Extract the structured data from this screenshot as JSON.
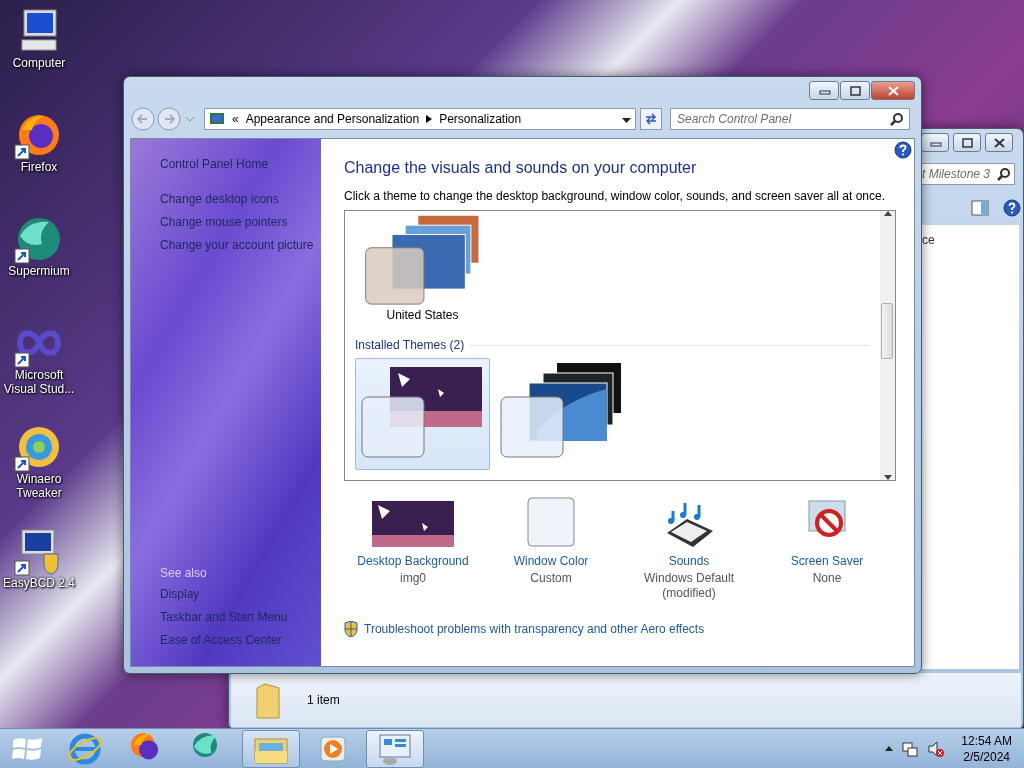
{
  "desktop_icons": [
    {
      "label": "Computer",
      "kind": "computer",
      "shortcut": false
    },
    {
      "label": "Firefox",
      "kind": "firefox",
      "shortcut": true
    },
    {
      "label": "Supermium",
      "kind": "supermium",
      "shortcut": true
    },
    {
      "label": "Microsoft Visual Stud...",
      "kind": "vs",
      "shortcut": true
    },
    {
      "label": "Winaero Tweaker",
      "kind": "winaero",
      "shortcut": true
    },
    {
      "label": "EasyBCD 2.4",
      "kind": "easybcd",
      "shortcut": true
    }
  ],
  "back_window": {
    "search": {
      "placeholder": "t Milestone 3"
    },
    "column_text": "ce",
    "status": "1 item"
  },
  "window": {
    "address": {
      "prefix": "«",
      "crumbs": [
        "Appearance and Personalization",
        "Personalization"
      ]
    },
    "search": {
      "placeholder": "Search Control Panel"
    },
    "sidebar": {
      "home": "Control Panel Home",
      "links": [
        "Change desktop icons",
        "Change mouse pointers",
        "Change your account picture"
      ],
      "see_also": "See also",
      "see_also_links": [
        "Display",
        "Taskbar and Start Menu",
        "Ease of Access Center"
      ]
    },
    "heading": "Change the visuals and sounds on your computer",
    "subtitle": "Click a theme to change the desktop background, window color, sounds, and screen saver all at once.",
    "theme_sections": [
      {
        "items": [
          {
            "name": "United States",
            "kind": "landscape",
            "selected": false
          }
        ]
      },
      {
        "title": "Installed Themes (2)",
        "items": [
          {
            "kind": "moonlight",
            "selected": true
          },
          {
            "kind": "dark",
            "selected": false
          }
        ]
      }
    ],
    "settings": [
      {
        "kind": "background",
        "label": "Desktop Background",
        "value": "img0"
      },
      {
        "kind": "color",
        "label": "Window Color",
        "value": "Custom"
      },
      {
        "kind": "sounds",
        "label": "Sounds",
        "value": "Windows Default (modified)"
      },
      {
        "kind": "screensaver",
        "label": "Screen Saver",
        "value": "None"
      }
    ],
    "troubleshoot": "Troubleshoot problems with transparency and other Aero effects"
  },
  "taskbar": {
    "items": [
      {
        "kind": "ie",
        "open": false,
        "selected": false
      },
      {
        "kind": "firefox",
        "open": false,
        "selected": false
      },
      {
        "kind": "supermium",
        "open": false,
        "selected": false
      },
      {
        "kind": "explorer",
        "open": true,
        "selected": false
      },
      {
        "kind": "media",
        "open": false,
        "selected": false
      },
      {
        "kind": "controlpanel",
        "open": true,
        "selected": true
      }
    ],
    "time": "12:54 AM",
    "date": "2/5/2024"
  }
}
